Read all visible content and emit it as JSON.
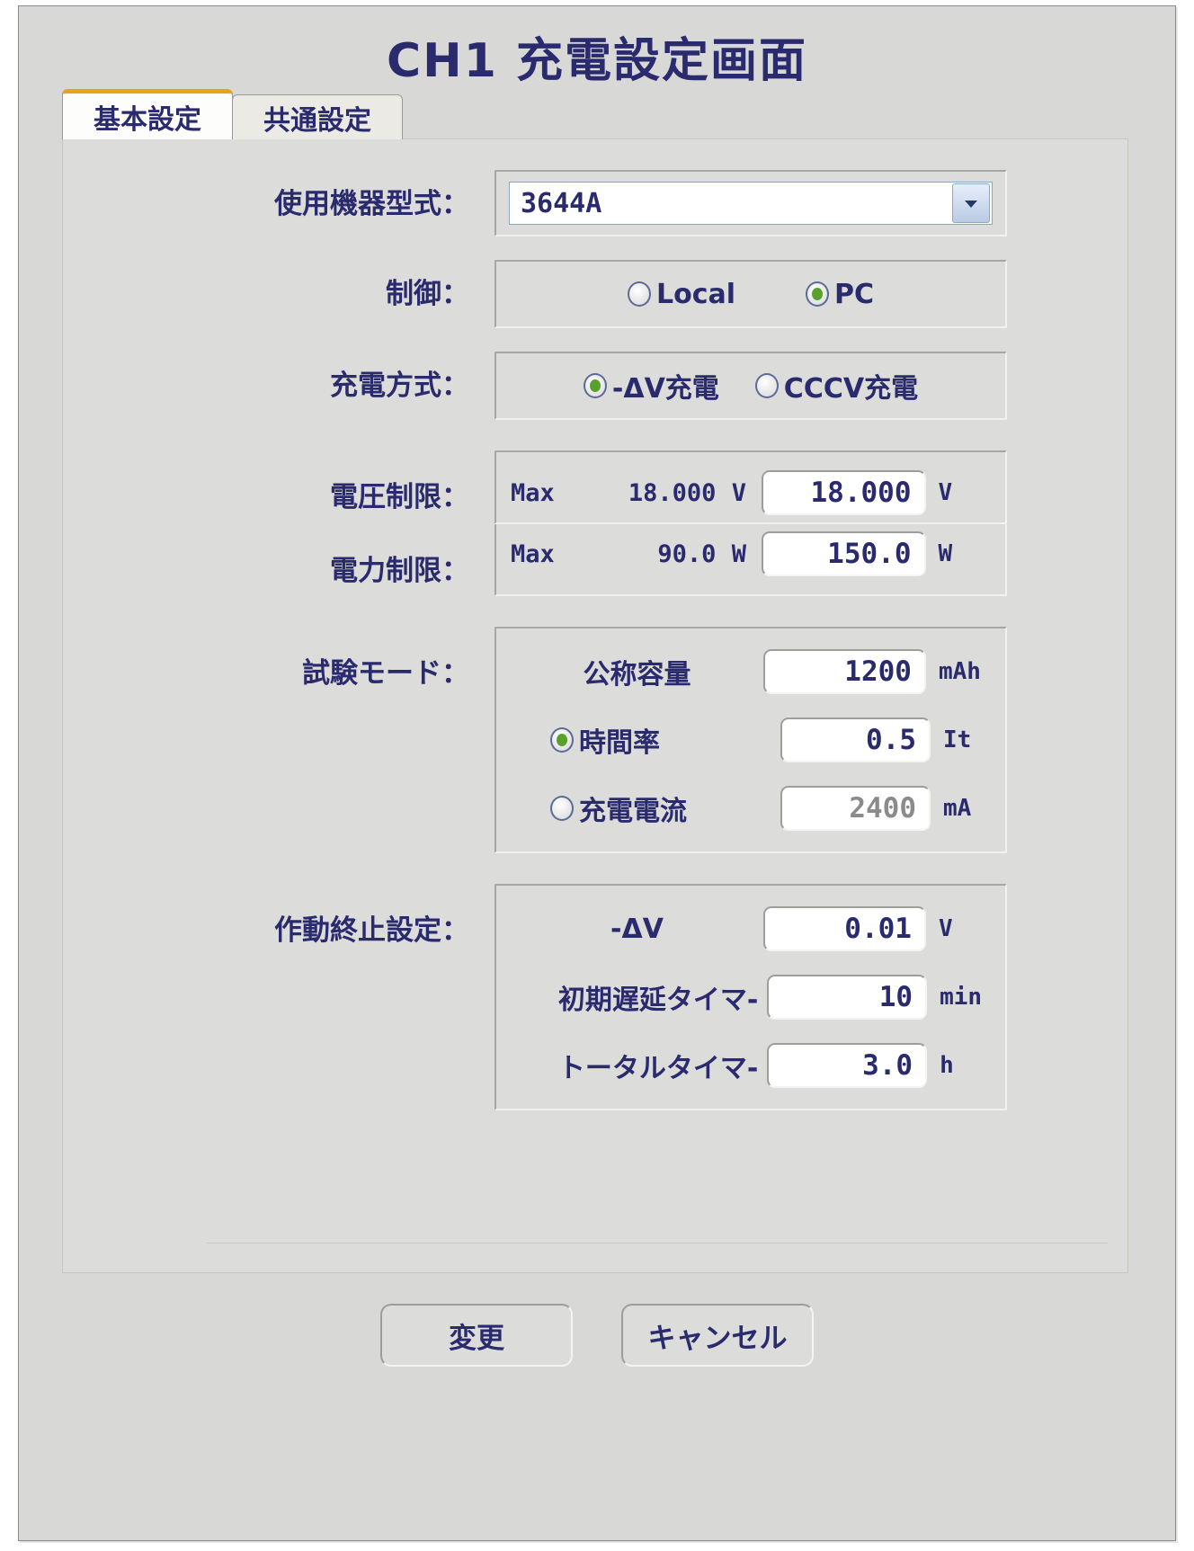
{
  "window": {
    "title": "CH1 充電設定画面"
  },
  "tabs": [
    {
      "label": "基本設定",
      "active": true
    },
    {
      "label": "共通設定",
      "active": false
    }
  ],
  "form": {
    "device_model": {
      "label": "使用機器型式：",
      "value": "3644A",
      "arrow_icon": "chevron-down-icon"
    },
    "control": {
      "label": "制御：",
      "options": [
        {
          "label": "Local",
          "selected": false
        },
        {
          "label": "PC",
          "selected": true
        }
      ]
    },
    "charge_method": {
      "label": "充電方式：",
      "options": [
        {
          "label": "-ΔV充電",
          "selected": true
        },
        {
          "label": "CCCV充電",
          "selected": false
        }
      ]
    },
    "voltage_limit": {
      "label": "電圧制限：",
      "max_label": "Max",
      "max_value": "18.000",
      "max_unit": "V",
      "value": "18.000",
      "unit": "V"
    },
    "power_limit": {
      "label": "電力制限：",
      "max_label": "Max",
      "max_value": "90.0",
      "max_unit": "W",
      "value": "150.0",
      "unit": "W"
    },
    "test_mode": {
      "label": "試験モード：",
      "nominal_capacity": {
        "name": "公称容量",
        "value": "1200",
        "unit": "mAh"
      },
      "hour_rate": {
        "name": "時間率",
        "selected": true,
        "value": "0.5",
        "unit": "It"
      },
      "charge_current": {
        "name": "充電電流",
        "selected": false,
        "value": "2400",
        "unit": "mA",
        "disabled": true
      }
    },
    "termination": {
      "label": "作動終止設定：",
      "delta_v": {
        "name": "-ΔV",
        "value": "0.01",
        "unit": "V"
      },
      "initial_delay_timer": {
        "name": "初期遅延タイマ-",
        "value": "10",
        "unit": "min"
      },
      "total_timer": {
        "name": "トータルタイマ-",
        "value": "3.0",
        "unit": "h"
      }
    }
  },
  "buttons": {
    "apply": "変更",
    "cancel": "キャンセル"
  },
  "colors": {
    "text_navy": "#2a2a6e",
    "panel_bg": "#dcdcda",
    "accent_tab": "#e8a317",
    "radio_on": "#5aa02c",
    "disabled_text": "#8b8b8b"
  }
}
